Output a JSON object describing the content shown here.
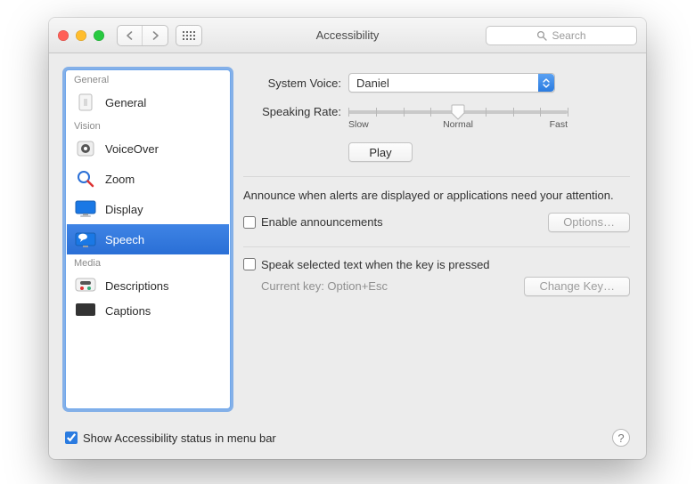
{
  "window": {
    "title": "Accessibility"
  },
  "toolbar": {
    "search_placeholder": "Search"
  },
  "sidebar": {
    "groups": {
      "general": "General",
      "vision": "Vision",
      "media": "Media"
    },
    "items": {
      "general": "General",
      "voiceover": "VoiceOver",
      "zoom": "Zoom",
      "display": "Display",
      "speech": "Speech",
      "descriptions": "Descriptions",
      "captions": "Captions"
    },
    "selected": "speech"
  },
  "speech": {
    "system_voice_label": "System Voice:",
    "system_voice_value": "Daniel",
    "speaking_rate_label": "Speaking Rate:",
    "rate_slow": "Slow",
    "rate_normal": "Normal",
    "rate_fast": "Fast",
    "play_label": "Play",
    "announce_desc": "Announce when alerts are displayed or applications need your attention.",
    "enable_announcements_label": "Enable announcements",
    "enable_announcements_checked": false,
    "options_label": "Options…",
    "speak_selected_label": "Speak selected text when the key is pressed",
    "speak_selected_checked": false,
    "current_key_label": "Current key: Option+Esc",
    "change_key_label": "Change Key…"
  },
  "footer": {
    "show_status_label": "Show Accessibility status in menu bar",
    "show_status_checked": true
  }
}
